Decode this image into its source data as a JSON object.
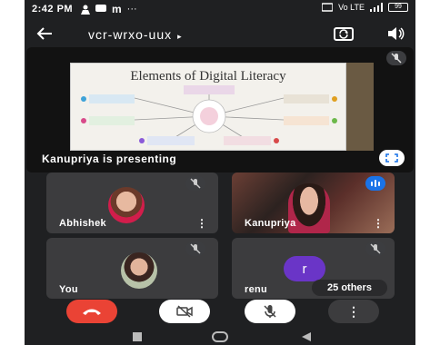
{
  "status_bar": {
    "time": "2:42 PM",
    "app_badge": "m",
    "overflow": "···",
    "signal_label": "Vo LTE",
    "battery": "99"
  },
  "top_bar": {
    "meeting_code": "vcr-wrxo-uux",
    "code_arrow": "▸"
  },
  "presentation": {
    "slide_title": "Elements of Digital Literacy",
    "presenter_label": "Kanupriya is presenting"
  },
  "participants": [
    {
      "name": "Abhishek",
      "muted": true
    },
    {
      "name": "Kanupriya",
      "muted": false,
      "speaking": true
    },
    {
      "name": "You",
      "muted": true
    },
    {
      "name": "renu",
      "muted": true,
      "initial": "r",
      "others": "25 others"
    }
  ],
  "colors": {
    "background": "#1f2022",
    "tile": "#3c3c3e",
    "end_call": "#ea4335",
    "avatar_purple": "#6a35c7",
    "speaking_blue": "#1a73e8"
  },
  "icons": [
    "back-arrow-icon",
    "switch-camera-icon",
    "speaker-icon",
    "mic-off-icon",
    "fullscreen-icon",
    "more-vert-icon",
    "end-call-icon",
    "camera-off-icon",
    "home-nav-icon",
    "recents-nav-icon",
    "back-nav-icon"
  ]
}
